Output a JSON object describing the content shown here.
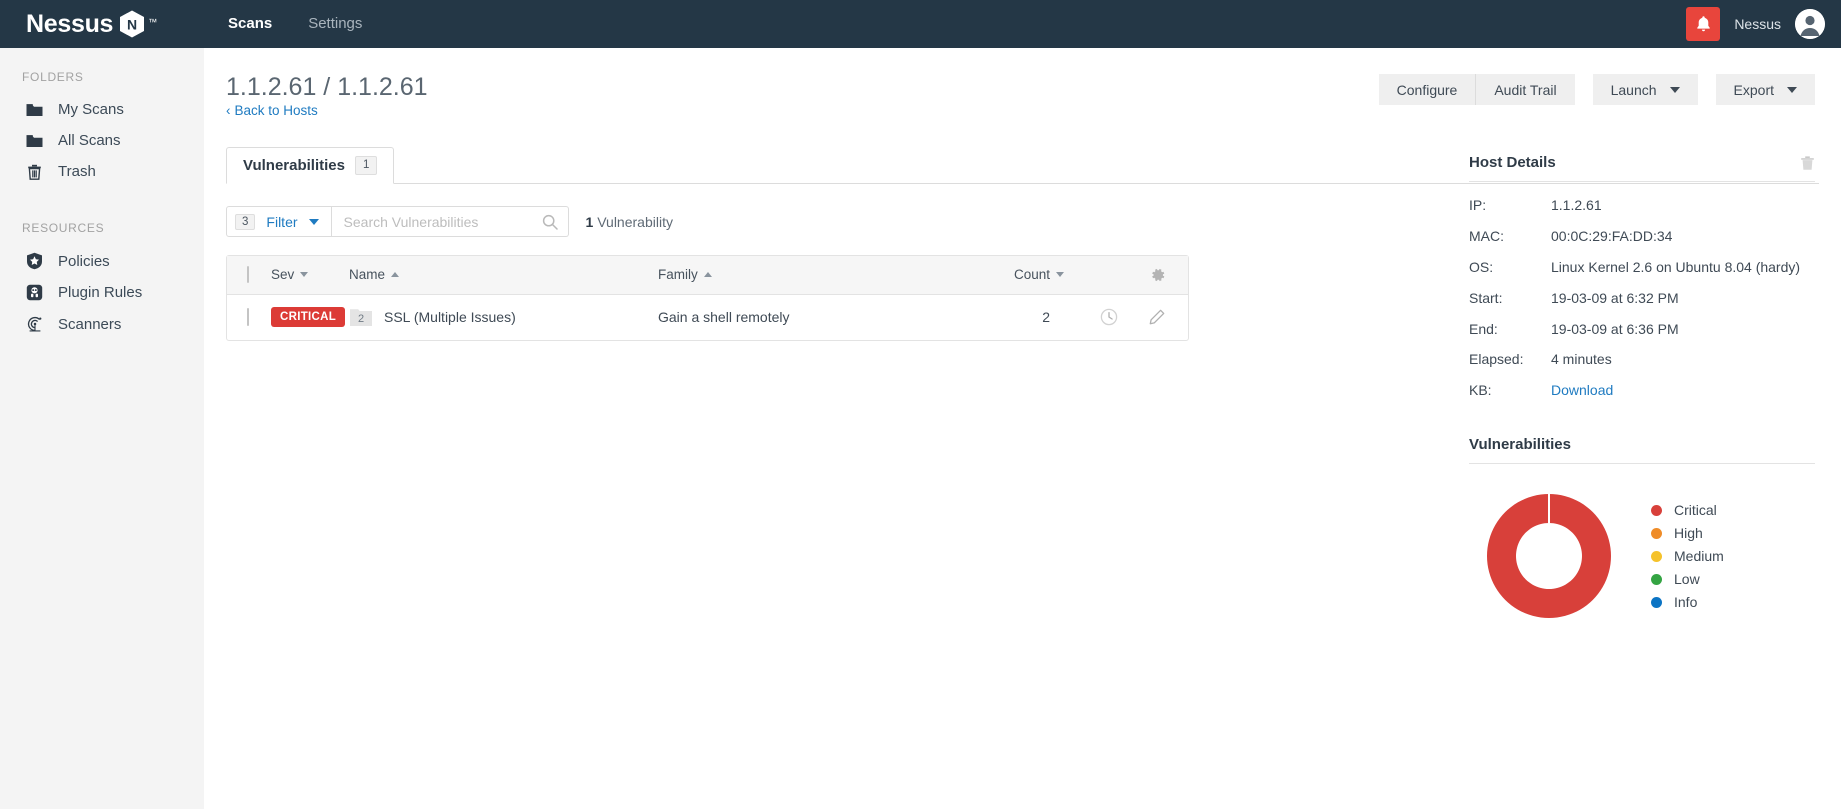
{
  "topbar": {
    "brand": "Nessus",
    "brand_badge_letter": "N",
    "trademark": "™",
    "nav": [
      {
        "label": "Scans",
        "active": true
      },
      {
        "label": "Settings",
        "active": false
      }
    ],
    "notification_icon": "bell-icon",
    "user_name": "Nessus",
    "avatar_icon": "user-avatar-icon"
  },
  "sidebar": {
    "folders_heading": "FOLDERS",
    "folders": [
      {
        "label": "My Scans",
        "icon": "folder-icon"
      },
      {
        "label": "All Scans",
        "icon": "folder-icon"
      },
      {
        "label": "Trash",
        "icon": "trash-icon"
      }
    ],
    "resources_heading": "RESOURCES",
    "resources": [
      {
        "label": "Policies",
        "icon": "shield-star-icon"
      },
      {
        "label": "Plugin Rules",
        "icon": "plugin-chip-icon"
      },
      {
        "label": "Scanners",
        "icon": "radar-icon"
      }
    ]
  },
  "page": {
    "title": "1.1.2.61 / 1.1.2.61",
    "back_link": "Back to Hosts",
    "back_caret": "‹"
  },
  "actions": {
    "configure": "Configure",
    "audit_trail": "Audit Trail",
    "launch": "Launch",
    "export": "Export"
  },
  "tabs": [
    {
      "label": "Vulnerabilities",
      "badge": "1",
      "active": true
    }
  ],
  "filters": {
    "count_badge": "3",
    "filter_label": "Filter",
    "search_placeholder": "Search Vulnerabilities",
    "search_value": "",
    "result_count_number": "1",
    "result_count_label": "Vulnerability"
  },
  "table": {
    "columns": [
      {
        "label": "Sev",
        "sort": "desc"
      },
      {
        "label": "Name",
        "sort": "asc"
      },
      {
        "label": "Family",
        "sort": "asc"
      },
      {
        "label": "Count",
        "sort": "desc"
      }
    ],
    "settings_icon": "gear-icon",
    "rows": [
      {
        "severity": "CRITICAL",
        "group_count": "2",
        "name": "SSL (Multiple Issues)",
        "family": "Gain a shell remotely",
        "count": "2",
        "history_icon": "clock-icon",
        "edit_icon": "pencil-icon"
      }
    ]
  },
  "host_details": {
    "title": "Host Details",
    "delete_icon": "trash-icon",
    "fields": [
      {
        "key": "IP:",
        "value": "1.1.2.61",
        "link": false
      },
      {
        "key": "MAC:",
        "value": "00:0C:29:FA:DD:34",
        "link": false
      },
      {
        "key": "OS:",
        "value": "Linux Kernel 2.6 on Ubuntu 8.04 (hardy)",
        "link": false
      },
      {
        "key": "Start:",
        "value": "19-03-09 at 6:32 PM",
        "link": false
      },
      {
        "key": "End:",
        "value": "19-03-09 at 6:36 PM",
        "link": false
      },
      {
        "key": "Elapsed:",
        "value": "4 minutes",
        "link": false
      },
      {
        "key": "KB:",
        "value": "Download",
        "link": true
      }
    ]
  },
  "chart_data": {
    "type": "pie",
    "title": "Vulnerabilities",
    "variant": "donut",
    "categories": [
      "Critical",
      "High",
      "Medium",
      "Low",
      "Info"
    ],
    "values": [
      1,
      0,
      0,
      0,
      0
    ],
    "colors": [
      "#d8403a",
      "#ef8c28",
      "#f5c22b",
      "#34a443",
      "#0b74c4"
    ],
    "legend_position": "right",
    "grid": false
  },
  "colors": {
    "header_bg": "#243746",
    "sidebar_bg": "#f4f4f4",
    "accent_link": "#1f7bc1",
    "critical": "#dc3b36",
    "alert": "#e8453c"
  }
}
